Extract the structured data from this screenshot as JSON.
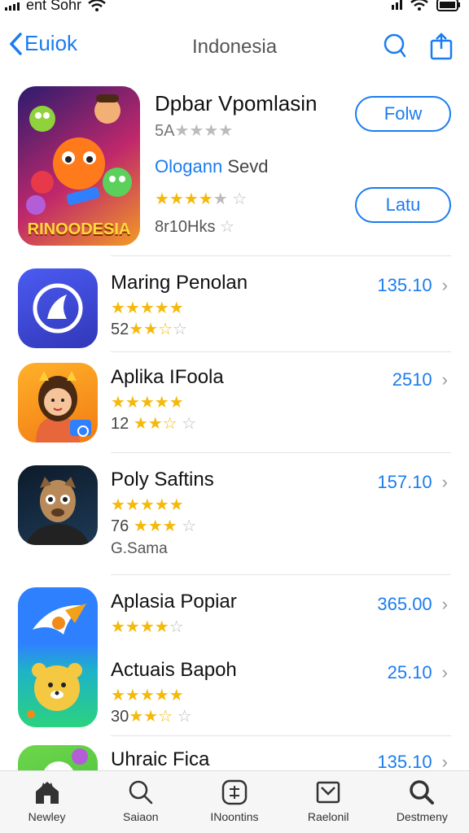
{
  "status_bar": {
    "carrier": "ent Sohr"
  },
  "nav": {
    "back_label": "Euiok",
    "title": "Indonesia"
  },
  "featured": {
    "hero_text": "RINOODESIA",
    "title": "Dpbar Vpomlasin",
    "rating_count": "5A",
    "link_text": "Ologann",
    "link_suffix": "Sevd",
    "downloads": "8r10Hks",
    "primary_button": "Folw",
    "secondary_button": "Latu"
  },
  "apps": [
    {
      "name": "Maring Penolan",
      "sub": "52",
      "price": "135.10",
      "stars": 5,
      "sub_stars": "2.5"
    },
    {
      "name": "Aplika IFoola",
      "sub": "12",
      "price": "2510",
      "stars": 4.5,
      "sub_stars": "2.5"
    },
    {
      "name": "Poly Saftins",
      "sub": "76",
      "extra": "G.Sama",
      "price": "157.10",
      "stars": 5,
      "sub_stars": "3"
    },
    {
      "name": "Aplasia Popiar",
      "price": "365.00",
      "stars": 4
    },
    {
      "name": "Actuais Bapoh",
      "sub": "30",
      "price": "25.10",
      "stars": 5,
      "sub_stars": "2.5"
    },
    {
      "name": "Uhraic Fica",
      "price": "135.10"
    }
  ],
  "tabs": [
    {
      "label": "Newley",
      "icon": "home-icon"
    },
    {
      "label": "Saiaon",
      "icon": "search-icon"
    },
    {
      "label": "INoontins",
      "icon": "apps-icon"
    },
    {
      "label": "Raelonil",
      "icon": "inbox-icon"
    },
    {
      "label": "Destmeny",
      "icon": "magnifier-icon"
    }
  ],
  "colors": {
    "accent": "#1a7cf0",
    "star": "#f5b90a"
  }
}
